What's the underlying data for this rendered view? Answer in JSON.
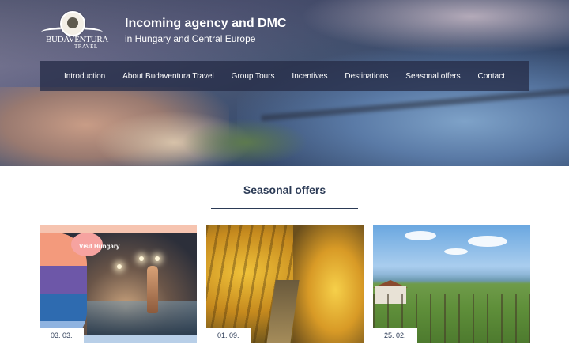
{
  "header": {
    "logo_name": "BUDAVENTURA",
    "logo_sub": "TRAVEL",
    "tagline_title": "Incoming agency and DMC",
    "tagline_sub": "in Hungary and Central Europe"
  },
  "nav": {
    "items": [
      {
        "label": "Introduction"
      },
      {
        "label": "About Budaventura Travel"
      },
      {
        "label": "Group Tours"
      },
      {
        "label": "Incentives"
      },
      {
        "label": "Destinations"
      },
      {
        "label": "Seasonal offers"
      },
      {
        "label": "Contact"
      }
    ]
  },
  "section": {
    "title": "Seasonal offers"
  },
  "offers": [
    {
      "date": "03. 03.",
      "overlay": "Visit Hungary"
    },
    {
      "date": "01. 09."
    },
    {
      "date": "25. 02."
    }
  ],
  "colors": {
    "navy": "#2b3a55",
    "nav_bg": "#262d48"
  }
}
